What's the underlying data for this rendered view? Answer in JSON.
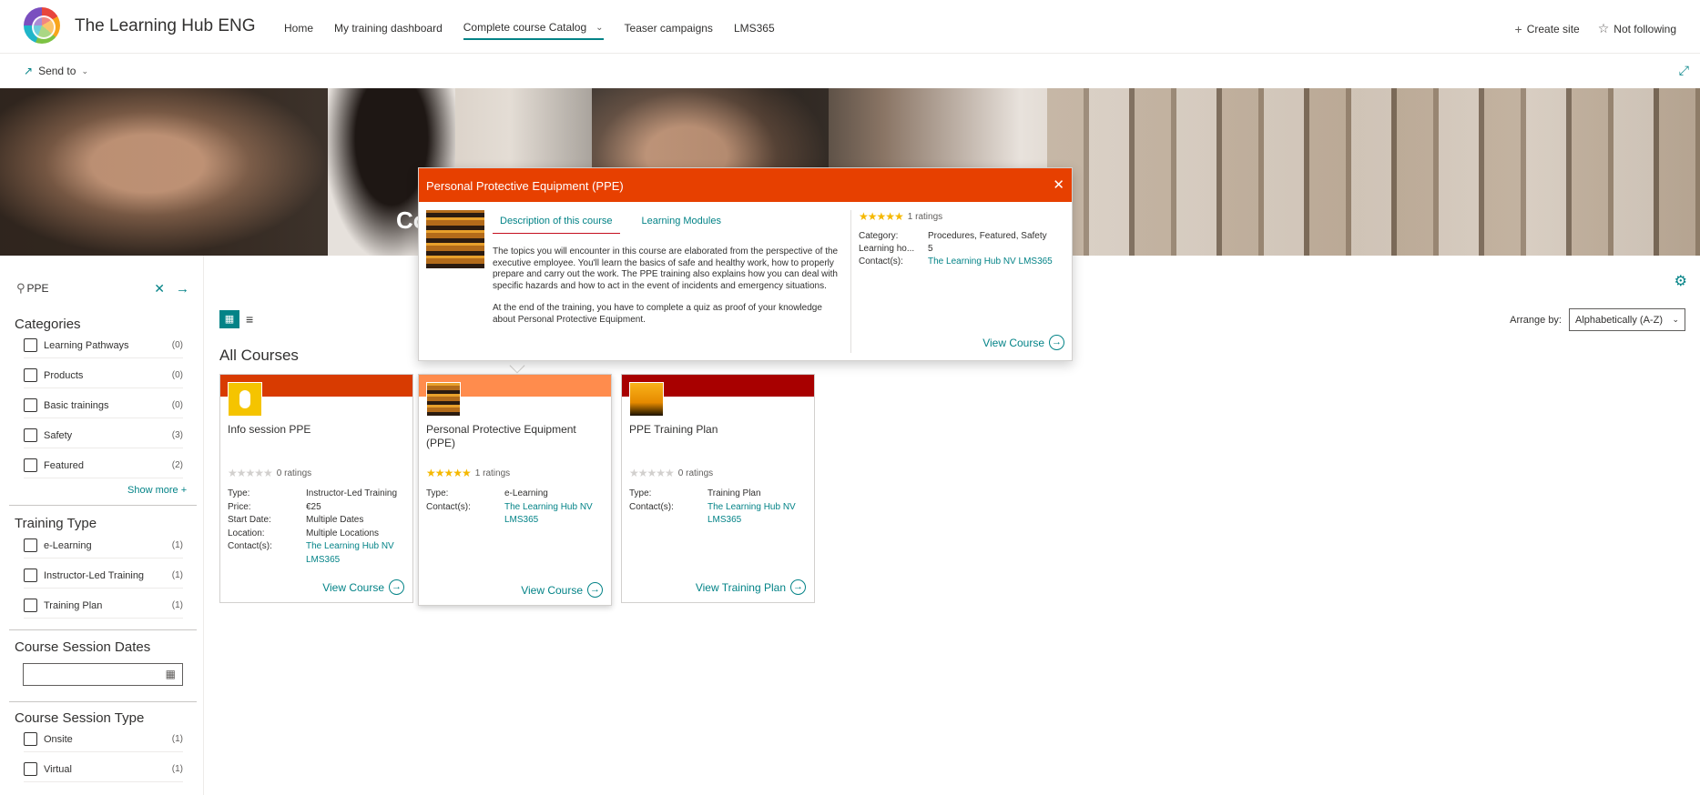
{
  "header": {
    "site_title": "The Learning Hub ENG",
    "nav": [
      {
        "label": "Home"
      },
      {
        "label": "My training dashboard"
      },
      {
        "label": "Complete course Catalog"
      },
      {
        "label": "Teaser campaigns"
      },
      {
        "label": "LMS365"
      }
    ],
    "create_site": "Create site",
    "not_following": "Not following"
  },
  "command_bar": {
    "send_to": "Send to"
  },
  "hero": {
    "title": "Co"
  },
  "sidebar": {
    "search_value": "PPE",
    "categories_title": "Categories",
    "categories": [
      {
        "label": "Learning Pathways",
        "count": "(0)"
      },
      {
        "label": "Products",
        "count": "(0)"
      },
      {
        "label": "Basic trainings",
        "count": "(0)"
      },
      {
        "label": "Safety",
        "count": "(3)"
      },
      {
        "label": "Featured",
        "count": "(2)"
      }
    ],
    "show_more": "Show more +",
    "training_type_title": "Training Type",
    "training_types": [
      {
        "label": "e-Learning",
        "count": "(1)"
      },
      {
        "label": "Instructor-Led Training",
        "count": "(1)"
      },
      {
        "label": "Training Plan",
        "count": "(1)"
      }
    ],
    "session_dates_title": "Course Session Dates",
    "session_type_title": "Course Session Type",
    "session_types": [
      {
        "label": "Onsite",
        "count": "(1)"
      },
      {
        "label": "Virtual",
        "count": "(1)"
      }
    ]
  },
  "main": {
    "all_courses": "All Courses",
    "arrange_label": "Arrange by:",
    "arrange_value": "Alphabetically (A-Z)"
  },
  "cards": [
    {
      "title": "Info session PPE",
      "band_color": "#d83b01",
      "stars": "★★★★★",
      "ratings": "0 ratings",
      "meta": [
        {
          "k": "Type:",
          "v": "Instructor-Led Training"
        },
        {
          "k": "Price:",
          "v": "€25"
        },
        {
          "k": "Start Date:",
          "v": "Multiple Dates"
        },
        {
          "k": "Location:",
          "v": "Multiple Locations"
        },
        {
          "k": "Contact(s):",
          "v": "The Learning Hub NV LMS365"
        }
      ],
      "button": "View Course"
    },
    {
      "title": "Personal Protective Equipment (PPE)",
      "band_color": "#ff8c4d",
      "stars": "★★★★★",
      "ratings": "1 ratings",
      "meta": [
        {
          "k": "Type:",
          "v": "e-Learning"
        },
        {
          "k": "Contact(s):",
          "v": "The Learning Hub NV LMS365"
        }
      ],
      "button": "View Course"
    },
    {
      "title": "PPE Training Plan",
      "band_color": "#a80000",
      "stars": "★★★★★",
      "ratings": "0 ratings",
      "meta": [
        {
          "k": "Type:",
          "v": "Training Plan"
        },
        {
          "k": "Contact(s):",
          "v": "The Learning Hub NV LMS365"
        }
      ],
      "button": "View Training Plan"
    }
  ],
  "popup": {
    "title": "Personal Protective Equipment (PPE)",
    "tab_description": "Description of this course",
    "tab_modules": "Learning Modules",
    "description_1": "The topics you will encounter in this course are elaborated from the perspective of the executive employee. You'll learn the basics of safe and healthy work, how to properly prepare and carry out the work. The PPE training also explains how you can deal with specific hazards and how to act in the event of incidents and emergency situations.",
    "description_2": "At the end of the training, you have to complete a quiz as proof of your knowledge about Personal Protective Equipment.",
    "stars": "★★★★★",
    "ratings": "1 ratings",
    "meta": [
      {
        "k": "Category:",
        "v": "Procedures, Featured, Safety"
      },
      {
        "k": "Learning ho...",
        "v": "5"
      },
      {
        "k": "Contact(s):",
        "v": "The Learning Hub NV LMS365"
      }
    ],
    "button": "View Course"
  },
  "colors": {
    "accent": "#038387",
    "popup_header": "#e74000"
  }
}
